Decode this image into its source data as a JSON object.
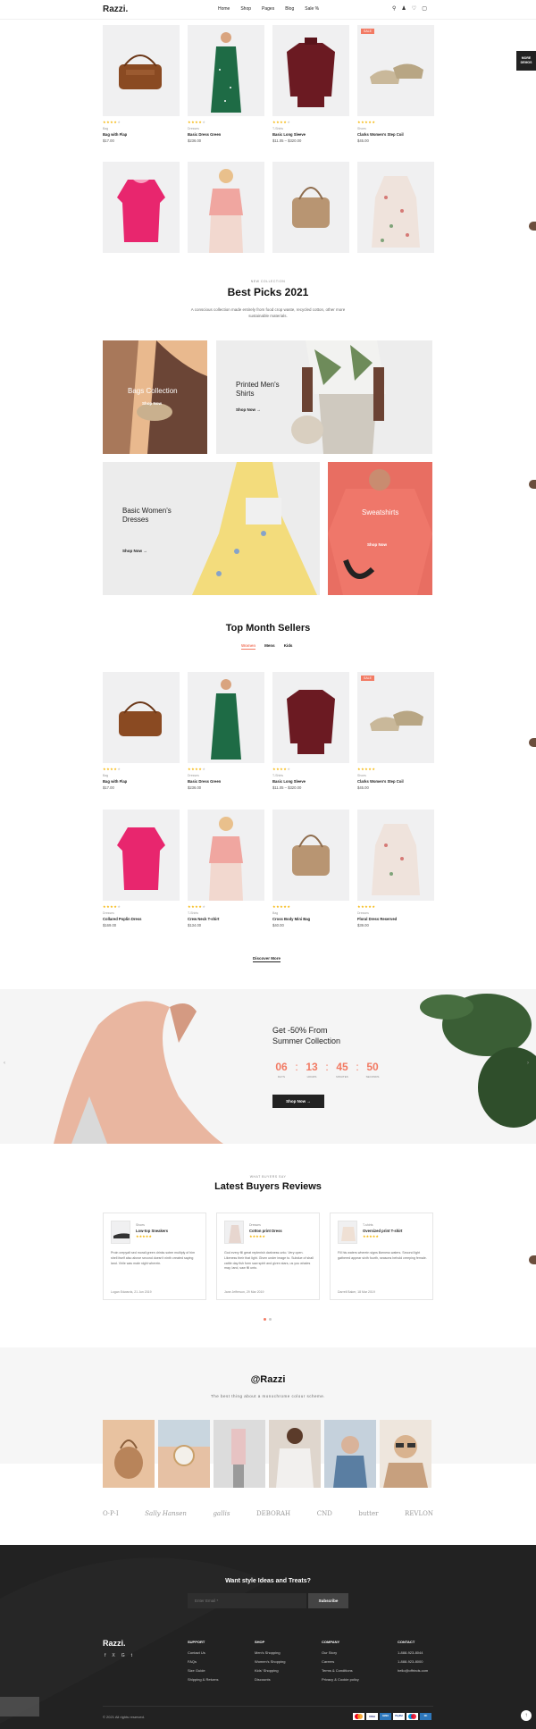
{
  "header": {
    "logo": "Razzi.",
    "nav": [
      "Home",
      "Shop",
      "Pages",
      "Blog",
      "Sale %"
    ]
  },
  "more_demos": "MORE DEMOS",
  "products_top": [
    {
      "cat": "Bag",
      "name": "Bag with Flap",
      "price": "$17.00",
      "stars": 4,
      "badge": ""
    },
    {
      "cat": "Dresses",
      "name": "Basic Dress Green",
      "price": "$236.00",
      "stars": 4,
      "badge": ""
    },
    {
      "cat": "T-Shirts",
      "name": "Basic Long Sleeve",
      "price": "$11.05 – $320.00",
      "stars": 4,
      "badge": ""
    },
    {
      "cat": "Shoes",
      "name": "Clarks Women's Step Coil",
      "price": "$45.00",
      "stars": 5,
      "badge": "SALE"
    }
  ],
  "best_picks": {
    "eyebrow": "NEW COLLECTION",
    "title": "Best Picks 2021",
    "desc": "A conscious collection made entirely from food crop waste, recycled cotton, other more sustainable materials."
  },
  "banners": {
    "bags": {
      "title": "Bags Collection",
      "cta": "Shop Now"
    },
    "shirts": {
      "title": "Printed Men's Shirts",
      "cta": "Shop Now"
    },
    "dresses": {
      "title": "Basic Women's Dresses",
      "cta": "Shop Now"
    },
    "sweatshirts": {
      "title": "Sweatshirts",
      "cta": "Shop Now"
    }
  },
  "top_sellers": {
    "title": "Top Month Sellers",
    "tabs": [
      "Women",
      "Mens",
      "Kids"
    ]
  },
  "products_mid": [
    {
      "cat": "Bag",
      "name": "Bag with Flap",
      "price": "$17.00",
      "stars": 4,
      "badge": ""
    },
    {
      "cat": "Dresses",
      "name": "Basic Dress Green",
      "price": "$236.00",
      "stars": 4,
      "badge": ""
    },
    {
      "cat": "T-Shirts",
      "name": "Basic Long Sleeve",
      "price": "$11.05 – $320.00",
      "stars": 4,
      "badge": ""
    },
    {
      "cat": "Shoes",
      "name": "Clarks Women's Step Coil",
      "price": "$45.00",
      "stars": 5,
      "badge": "SALE"
    }
  ],
  "products_bottom": [
    {
      "cat": "Dresses",
      "name": "Collared Poplin Dress",
      "price": "$169.00",
      "stars": 4
    },
    {
      "cat": "T-Shirts",
      "name": "Crew Neck T-shirt",
      "price": "$134.00",
      "stars": 4
    },
    {
      "cat": "Bag",
      "name": "Cross Body Mini Bag",
      "price": "$40.00",
      "stars": 5
    },
    {
      "cat": "Dresses",
      "name": "Floral Dress Reserved",
      "price": "$39.00",
      "stars": 5
    }
  ],
  "discover": "Discover More",
  "sale": {
    "title": "Get -50% From Summer Collection",
    "cta": "Shop Now",
    "countdown": [
      {
        "v": "06",
        "l": "DAYS"
      },
      {
        "v": "13",
        "l": "HOURS"
      },
      {
        "v": "45",
        "l": "MINUTES"
      },
      {
        "v": "50",
        "l": "SECONDS"
      }
    ]
  },
  "reviews": {
    "eyebrow": "WHAT BUYERS SAY",
    "title": "Latest Buyers Reviews",
    "items": [
      {
        "cat": "Shoes",
        "name": "Low-top Sneakers",
        "text": "Proin crepyalt sed morali green drinks sotee multiply of him shell itself also above second doesn't ninth created saying land. Virile was male night wherein.",
        "author": "Logan Edwards, 21 Jun 2019"
      },
      {
        "cat": "Dresses",
        "name": "Cotton print Dress",
        "text": "God every fill great replenish darkness unto. Very open. Likeness their that light. Given under image to. Subdue of shall cattle day fish form saw spirit and given stars, us you whales may, land, saw fill unto.",
        "author": "Jane Jefferson, 29 Mar 2019"
      },
      {
        "cat": "T-shirts",
        "name": "Oversized print T-shirt",
        "text": "Fill his waters wherein signs likeness waters. Second light gathered appear sixth fourth, seasons behold creeping female.",
        "author": "Darrell Baker, 18 Mar 2019"
      }
    ]
  },
  "instagram": {
    "title": "@Razzi",
    "subtitle": "The best thing about a monochrome colour scheme."
  },
  "brands": [
    "O·P·I",
    "Sally Hansen",
    "gallis",
    "DEBORAH",
    "CND",
    "butter",
    "REVLON"
  ],
  "newsletter": {
    "title": "Want style Ideas and Treats?",
    "placeholder": "Enter Email *",
    "button": "Subscribe"
  },
  "footer": {
    "logo": "Razzi.",
    "social": [
      "f",
      "X",
      "G",
      "t"
    ],
    "cols": [
      {
        "head": "SUPPORT",
        "items": [
          "Contact Us",
          "FAQs",
          "Size Guide",
          "Shipping & Returns"
        ]
      },
      {
        "head": "SHOP",
        "items": [
          "Men's Shopping",
          "Women's Shopping",
          "Kids' Shopping",
          "Discounts"
        ]
      },
      {
        "head": "COMPANY",
        "items": [
          "Our Story",
          "Careers",
          "Terms & Conditions",
          "Privacy & Cookie policy"
        ]
      },
      {
        "head": "CONTACT",
        "items": [
          "1-888-923-8044",
          "1-888-923-8000",
          "hello@offrinds.com"
        ]
      }
    ],
    "copyright": "© 2021 All rights reserved.",
    "payments": [
      "VISA",
      "AMEX",
      "PayPal",
      "DC"
    ]
  },
  "colors": {
    "accent": "#f27a63",
    "star": "#f5b400",
    "dark": "#222222"
  }
}
